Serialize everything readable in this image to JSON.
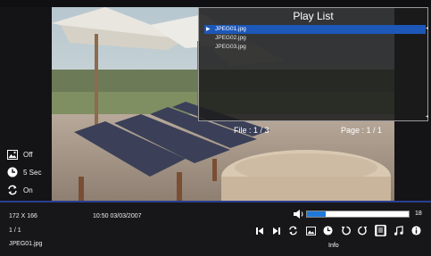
{
  "playlist": {
    "title": "Play List",
    "items": [
      {
        "label": "JPEG01.jpg",
        "selected": true
      },
      {
        "label": "JPEG02.jpg",
        "selected": false
      },
      {
        "label": "JPEG03.jpg",
        "selected": false
      }
    ],
    "file_info": "File : 1 / 3",
    "page_info": "Page : 1 / 1"
  },
  "settings": {
    "display": {
      "icon": "image-icon",
      "label": "Off"
    },
    "interval": {
      "icon": "clock-icon",
      "label": "5 Sec"
    },
    "repeat": {
      "icon": "repeat-icon",
      "label": "On"
    }
  },
  "status": {
    "resolution": "172 X 166",
    "datetime": "10:50 03/03/2007",
    "index": "1 / 1",
    "filename": "JPEG01.jpg"
  },
  "volume": {
    "level": 18,
    "fill_fraction": 0.18
  },
  "controls": {
    "items": [
      "prev-icon",
      "next-icon",
      "repeat-icon",
      "image-icon",
      "clock-icon",
      "rotate-left-icon",
      "rotate-right-icon",
      "info-icon-doc",
      "music-icon",
      "info-icon"
    ],
    "active": "info-icon-doc",
    "active_label": "Info"
  },
  "colors": {
    "accent": "#1d57b8",
    "volume_fill": "#1f79d9",
    "bar_line": "#2a3f8f"
  }
}
